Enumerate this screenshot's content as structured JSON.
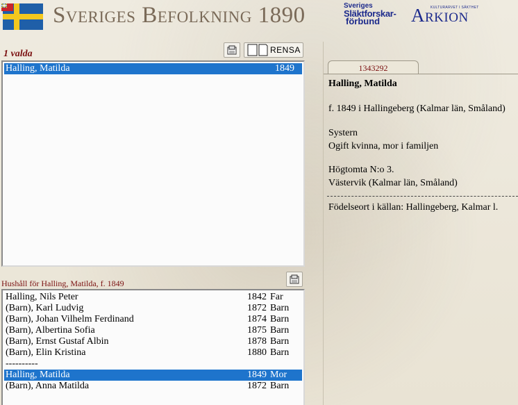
{
  "header": {
    "title": "Sveriges Befolkning 1890",
    "ssf_logo": [
      "Sveriges",
      "Släktforskar-",
      "förbund"
    ],
    "arkion_tagline": "KULTURARVET I SÄKTHET",
    "arkion_name": "Arkion"
  },
  "selection": {
    "count_label": "1 valda",
    "clear_label": "RENSA",
    "items": [
      {
        "name": "Halling, Matilda",
        "year": "1849",
        "selected": true
      }
    ]
  },
  "household": {
    "title": "Hushåll för Halling, Matilda, f. 1849",
    "separator": "----------",
    "members": [
      {
        "name": "Halling, Nils Peter",
        "year": "1842",
        "role": "Far"
      },
      {
        "name": "(Barn), Karl Ludvig",
        "year": "1872",
        "role": "Barn"
      },
      {
        "name": "(Barn), Johan Vilhelm Ferdinand",
        "year": "1874",
        "role": "Barn"
      },
      {
        "name": "(Barn), Albertina Sofia",
        "year": "1875",
        "role": "Barn"
      },
      {
        "name": "(Barn), Ernst Gustaf Albin",
        "year": "1878",
        "role": "Barn"
      },
      {
        "name": "(Barn), Elin Kristina",
        "year": "1880",
        "role": "Barn"
      }
    ],
    "after_separator": [
      {
        "name": "Halling, Matilda",
        "year": "1849",
        "role": "Mor",
        "selected": true
      },
      {
        "name": "(Barn), Anna Matilda",
        "year": "1872",
        "role": "Barn"
      }
    ]
  },
  "detail": {
    "tab_id": "1343292",
    "name": "Halling, Matilda",
    "birth": "f. 1849 i Hallingeberg (Kalmar län, Småland)",
    "relation": "Systern",
    "status": "Ogift kvinna, mor i familjen",
    "address": "Högtomta N:o 3.",
    "parish": "Västervik (Kalmar län, Småland)",
    "source_birthplace": "Födelseort i källan: Hallingeberg, Kalmar l."
  },
  "colors": {
    "selection": "#1e74cc",
    "accent_red": "#7a1010",
    "logo_blue": "#1c2a8c",
    "title_brown": "#7a6a58"
  }
}
